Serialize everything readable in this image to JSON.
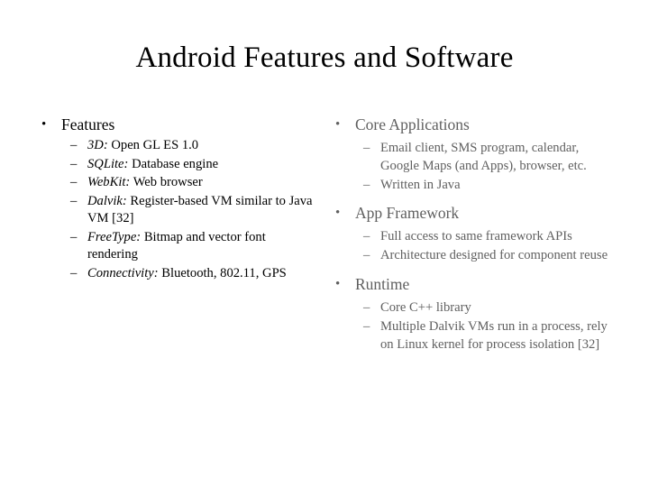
{
  "slide": {
    "title": "Android Features and Software",
    "background_color": "#ffffff",
    "left_column_color": "#000000",
    "right_column_color": "#5f5f5f",
    "bullet_marker": "•",
    "sub_bullet_marker": "–"
  },
  "left_column": {
    "heading": "Features",
    "items": [
      {
        "term": "3D:",
        "desc": "Open GL ES 1.0",
        "full": "3D:  Open GL ES 1.0"
      },
      {
        "term": "SQLite:",
        "desc": "Database engine",
        "full": "SQLite:  Database engine"
      },
      {
        "term": "WebKit:",
        "desc": "Web browser",
        "full": "WebKit:  Web browser"
      },
      {
        "term": "Dalvik:",
        "desc": "Register-based VM similar to Java VM [32]",
        "full": "Dalvik:  Register-based VM similar to Java VM [32]"
      },
      {
        "term": "FreeType:",
        "desc": "Bitmap and vector font rendering",
        "full": "FreeType: Bitmap and vector font rendering"
      },
      {
        "term": "Connectivity:",
        "desc": "Bluetooth, 802.11, GPS",
        "full": "Connectivity:  Bluetooth, 802.11, GPS"
      }
    ]
  },
  "right_column": {
    "groups": [
      {
        "heading": "Core Applications",
        "items": [
          "Email client, SMS program, calendar, Google Maps (and Apps), browser, etc.",
          "Written in Java"
        ]
      },
      {
        "heading": "App Framework",
        "items": [
          "Full access to same framework APIs",
          "Architecture designed for component reuse"
        ]
      },
      {
        "heading": "Runtime",
        "items": [
          "Core C++ library",
          "Multiple Dalvik VMs run in a process, rely on Linux kernel for process isolation [32]"
        ]
      }
    ]
  }
}
